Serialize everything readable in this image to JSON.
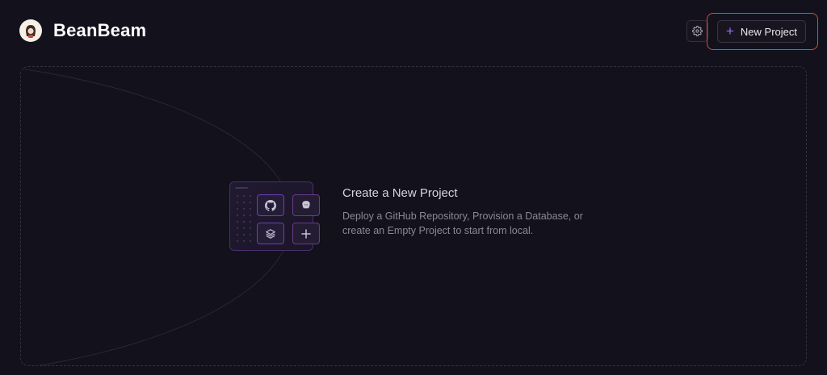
{
  "app": {
    "name": "BeanBeam",
    "logo_icon": "avatar-logo-icon"
  },
  "header": {
    "settings_icon": "gear-icon",
    "new_project_label": "New Project",
    "new_project_icon": "plus-icon"
  },
  "empty_state": {
    "title": "Create a New Project",
    "description": "Deploy a GitHub Repository, Provision a Database, or create an Empty Project to start from local.",
    "tiles": [
      {
        "icon": "github-icon"
      },
      {
        "icon": "postgres-icon"
      },
      {
        "icon": "layers-icon"
      },
      {
        "icon": "plus-icon"
      }
    ]
  },
  "colors": {
    "background": "#13111c",
    "accent": "#9b6ff0",
    "highlight": "#d8493d"
  }
}
